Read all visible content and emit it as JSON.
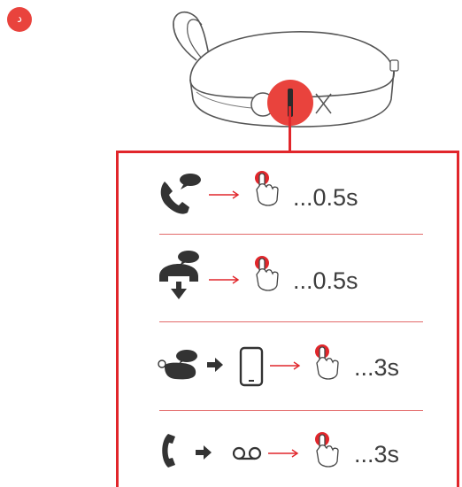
{
  "badge": {
    "label": "د"
  },
  "colors": {
    "accent": "#e1262b",
    "icon": "#333333",
    "outline": "#555555"
  },
  "rows": [
    {
      "name": "answer-call",
      "icon": "phone-ringing-icon",
      "action": "press",
      "duration": "...0.5s"
    },
    {
      "name": "end-call",
      "icon": "hang-up-icon",
      "action": "press",
      "duration": "...0.5s"
    },
    {
      "name": "transfer-to-phone",
      "icon": "earbud-to-phone-icon",
      "action": "hold",
      "duration": "...3s"
    },
    {
      "name": "voicemail",
      "icon": "phone-voicemail-icon",
      "action": "hold",
      "duration": "...3s"
    }
  ]
}
